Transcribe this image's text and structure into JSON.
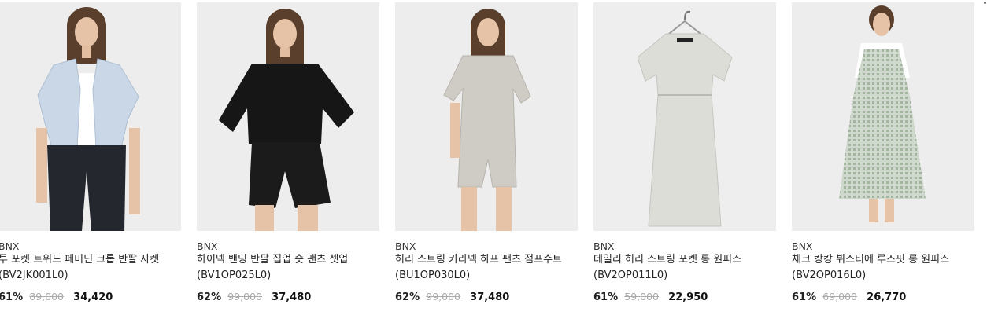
{
  "products": [
    {
      "brand": "BNX",
      "name": "투 포켓 트위드 페미닌 크롭 반팔 자켓 (BV2JK001L0)",
      "discount": "61%",
      "original_price": "89,000",
      "sale_price": "34,420"
    },
    {
      "brand": "BNX",
      "name": "하이넥 밴딩 반팔 집업 숏 팬츠 셋업 (BV1OP025L0)",
      "discount": "62%",
      "original_price": "99,000",
      "sale_price": "37,480"
    },
    {
      "brand": "BNX",
      "name": "허리 스트링 카라넥 하프 팬츠 점프수트 (BU1OP030L0)",
      "discount": "62%",
      "original_price": "99,000",
      "sale_price": "37,480"
    },
    {
      "brand": "BNX",
      "name": "데일리 허리 스트링 포켓 롱 원피스 (BV2OP011L0)",
      "discount": "61%",
      "original_price": "59,000",
      "sale_price": "22,950"
    },
    {
      "brand": "BNX",
      "name": "체크 캉캉 뷔스티에 루즈핏 롱 원피스 (BV2OP016L0)",
      "discount": "61%",
      "original_price": "69,000",
      "sale_price": "26,770"
    }
  ]
}
